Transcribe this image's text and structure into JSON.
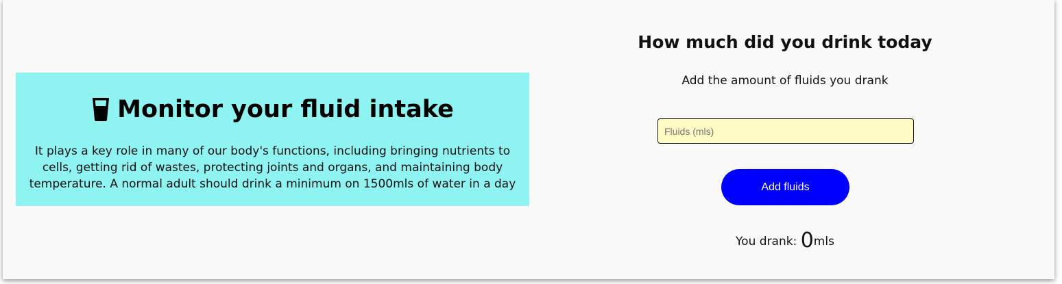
{
  "info": {
    "icon": "cup-icon",
    "title": "Monitor your fluid intake",
    "description": "It plays a key role in many of our body's functions, including bringing nutrients to cells, getting rid of wastes, protecting joints and organs, and maintaining body temperature. A normal adult should drink a minimum on 1500mls of water in a day",
    "background_color": "#8ef3f1"
  },
  "form": {
    "title": "How much did you drink today",
    "subtitle": "Add the amount of fluids you drank",
    "input_placeholder": "Fluids (mls)",
    "input_value": "",
    "button_label": "Add fluids",
    "button_color": "#0000ff"
  },
  "result": {
    "prefix": "You drank: ",
    "value": "0",
    "unit": "mls"
  }
}
